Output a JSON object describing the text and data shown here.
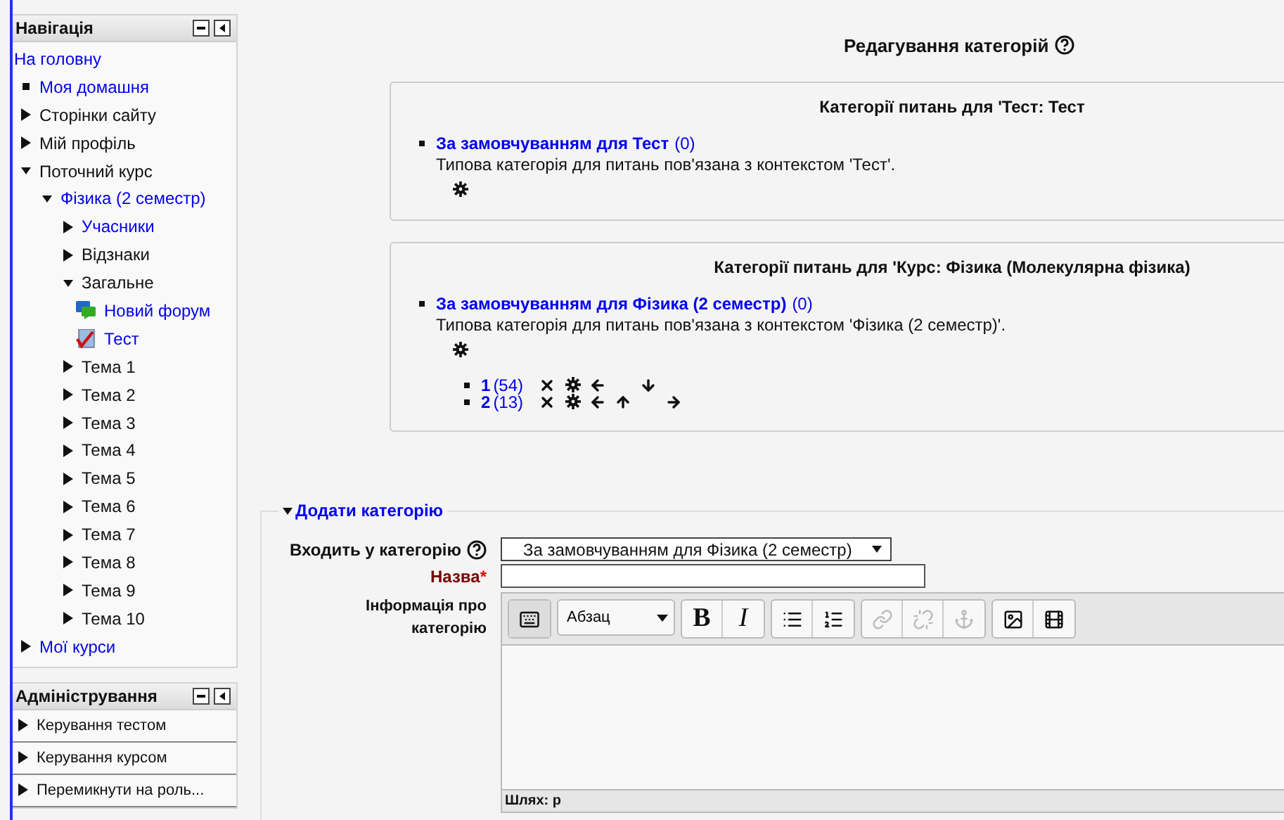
{
  "navigation": {
    "title": "Навігація",
    "items": [
      {
        "label": "На головну",
        "kind": "plain",
        "link": true
      },
      {
        "label": "Моя домашня",
        "kind": "leaf",
        "link": true
      },
      {
        "label": "Сторінки сайту",
        "kind": "branch",
        "expanded": false,
        "link": false
      },
      {
        "label": "Мій профіль",
        "kind": "branch",
        "expanded": false,
        "link": false
      },
      {
        "label": "Поточний курс",
        "kind": "branch",
        "expanded": true,
        "link": false,
        "children": [
          {
            "label": "Фізика (2 семестр)",
            "kind": "branch",
            "expanded": true,
            "link": true,
            "children": [
              {
                "label": "Учасники",
                "kind": "branch",
                "expanded": false,
                "link": true
              },
              {
                "label": "Відзнаки",
                "kind": "branch",
                "expanded": false,
                "link": false
              },
              {
                "label": "Загальне",
                "kind": "branch",
                "expanded": true,
                "link": false,
                "children": [
                  {
                    "label": "Новий форум",
                    "kind": "forum",
                    "link": true
                  },
                  {
                    "label": "Тест",
                    "kind": "quiz",
                    "link": true
                  }
                ]
              },
              {
                "label": "Тема 1",
                "kind": "branch",
                "expanded": false,
                "link": false
              },
              {
                "label": "Тема 2",
                "kind": "branch",
                "expanded": false,
                "link": false
              },
              {
                "label": "Тема 3",
                "kind": "branch",
                "expanded": false,
                "link": false
              },
              {
                "label": "Тема 4",
                "kind": "branch",
                "expanded": false,
                "link": false
              },
              {
                "label": "Тема 5",
                "kind": "branch",
                "expanded": false,
                "link": false
              },
              {
                "label": "Тема 6",
                "kind": "branch",
                "expanded": false,
                "link": false
              },
              {
                "label": "Тема 7",
                "kind": "branch",
                "expanded": false,
                "link": false
              },
              {
                "label": "Тема 8",
                "kind": "branch",
                "expanded": false,
                "link": false
              },
              {
                "label": "Тема 9",
                "kind": "branch",
                "expanded": false,
                "link": false
              },
              {
                "label": "Тема 10",
                "kind": "branch",
                "expanded": false,
                "link": false
              }
            ]
          }
        ]
      },
      {
        "label": "Мої курси",
        "kind": "branch",
        "expanded": false,
        "link": true
      }
    ]
  },
  "administration": {
    "title": "Адміністрування",
    "items": [
      {
        "label": "Керування тестом",
        "expanded": false
      },
      {
        "label": "Керування курсом",
        "expanded": false
      },
      {
        "label": "Перемикнути на роль...",
        "expanded": false
      }
    ]
  },
  "heading": "Редагування категорій",
  "contexts": [
    {
      "title": "Категорії питань для 'Тест: Тест",
      "categories": [
        {
          "name": "За замовчуванням для Тест",
          "count": "(0)",
          "description": "Типова категорія для питань пов'язана з контекстом 'Тест'.",
          "actions": [
            {
              "kind": "edit"
            }
          ]
        }
      ]
    },
    {
      "title": "Категорії питань для 'Курс: Фізика (Молекулярна фізика)",
      "categories": [
        {
          "name": "За замовчуванням для Фізика (2 семестр)",
          "count": "(0)",
          "description": "Типова категорія для питань пов'язана з контекстом 'Фізика (2 семестр)'.",
          "actions": [
            {
              "kind": "edit"
            }
          ],
          "children": [
            {
              "name": "1",
              "count": "(54)",
              "actions": [
                {
                  "kind": "delete"
                },
                {
                  "kind": "edit"
                },
                {
                  "kind": "left"
                },
                {
                  "kind": "down"
                }
              ]
            },
            {
              "name": "2",
              "count": "(13)",
              "actions": [
                {
                  "kind": "delete"
                },
                {
                  "kind": "edit"
                },
                {
                  "kind": "left"
                },
                {
                  "kind": "up"
                },
                {
                  "kind": "right"
                }
              ]
            }
          ]
        }
      ]
    }
  ],
  "add_form": {
    "legend": "Додати категорію",
    "expanded": true,
    "parent_label": "Входить у категорію",
    "parent_value": "За замовчуванням для Фізика (2 семестр)",
    "name_label": "Назва",
    "required_mark": "*",
    "info_label": "Інформація про категорію",
    "tool_groups": [
      [
        {
          "kind": "toggle",
          "disabled": false
        }
      ],
      [
        {
          "kind": "format",
          "text": "Абзац"
        }
      ],
      [
        {
          "kind": "bold",
          "text": "B",
          "disabled": false
        },
        {
          "kind": "italic",
          "text": "I",
          "disabled": false
        }
      ],
      [
        {
          "kind": "bullets",
          "disabled": false
        },
        {
          "kind": "numbers",
          "disabled": false
        }
      ],
      [
        {
          "kind": "link",
          "disabled": true
        },
        {
          "kind": "unlink",
          "disabled": true
        },
        {
          "kind": "anchor",
          "disabled": true
        }
      ],
      [
        {
          "kind": "image",
          "disabled": false
        },
        {
          "kind": "media",
          "disabled": false
        }
      ]
    ],
    "path": "Шлях: p"
  }
}
